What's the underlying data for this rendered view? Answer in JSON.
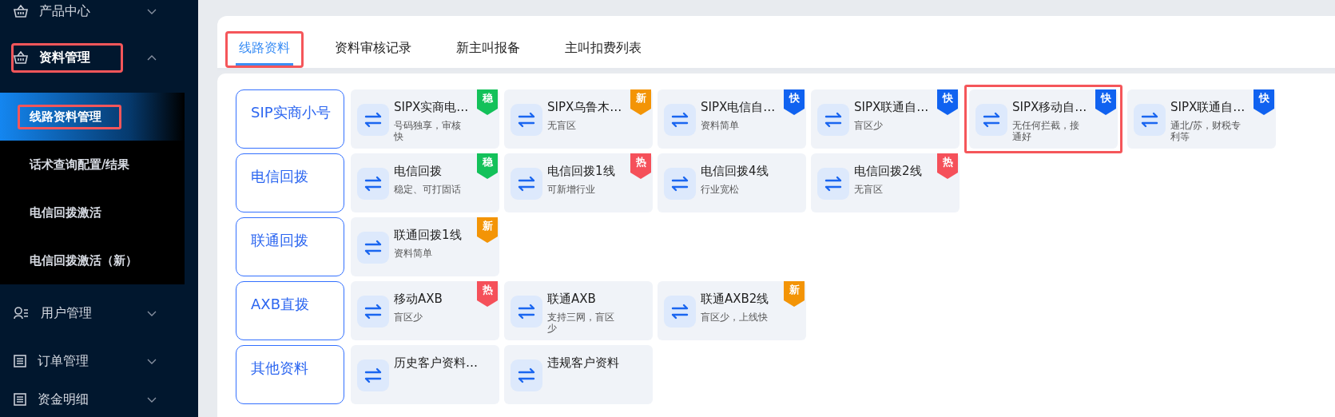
{
  "sidebar": {
    "items": [
      {
        "label": "产品中心",
        "expanded": false,
        "highlighted": false
      },
      {
        "label": "资料管理",
        "expanded": true,
        "highlighted": true,
        "children": [
          {
            "label": "线路资料管理",
            "selected": true,
            "highlighted": true
          },
          {
            "label": "话术查询配置/结果",
            "selected": false,
            "highlighted": false
          },
          {
            "label": "电信回拨激活",
            "selected": false,
            "highlighted": false
          },
          {
            "label": "电信回拨激活（新）",
            "selected": false,
            "highlighted": false
          }
        ]
      },
      {
        "label": "用户管理",
        "expanded": false,
        "highlighted": false
      },
      {
        "label": "订单管理",
        "expanded": false,
        "highlighted": false
      },
      {
        "label": "资金明细",
        "expanded": false,
        "highlighted": false
      }
    ]
  },
  "tabs": [
    {
      "label": "线路资料",
      "selected": true,
      "highlighted": true
    },
    {
      "label": "资料审核记录",
      "selected": false,
      "highlighted": false
    },
    {
      "label": "新主叫报备",
      "selected": false,
      "highlighted": false
    },
    {
      "label": "主叫扣费列表",
      "selected": false,
      "highlighted": false
    }
  ],
  "groups": [
    {
      "label": "SIP实商小号",
      "cards": [
        {
          "title": "SIPX实商电…",
          "desc": "号码独享，审核快",
          "badge": "稳",
          "color": "#13c15a",
          "highlighted": false
        },
        {
          "title": "SIPX乌鲁木…",
          "desc": "无盲区",
          "badge": "新",
          "color": "#f39406",
          "highlighted": false
        },
        {
          "title": "SIPX电信自…",
          "desc": "资料简单",
          "badge": "快",
          "color": "#1062f0",
          "highlighted": false
        },
        {
          "title": "SIPX联通自…",
          "desc": "盲区少",
          "badge": "快",
          "color": "#1062f0",
          "highlighted": false
        },
        {
          "title": "SIPX移动自…",
          "desc": "无任何拦截，接通好",
          "badge": "快",
          "color": "#1062f0",
          "highlighted": true
        },
        {
          "title": "SIPX联通自…",
          "desc": "通北/苏，财税专利等",
          "badge": "快",
          "color": "#1062f0",
          "highlighted": false
        }
      ]
    },
    {
      "label": "电信回拨",
      "cards": [
        {
          "title": "电信回拨",
          "desc": "稳定、可打固话",
          "badge": "稳",
          "color": "#13c15a",
          "highlighted": false
        },
        {
          "title": "电信回拨1线",
          "desc": "可新增行业",
          "badge": "热",
          "color": "#f5505a",
          "highlighted": false
        },
        {
          "title": "电信回拨4线",
          "desc": "行业宽松",
          "highlighted": false
        },
        {
          "title": "电信回拨2线",
          "desc": "无盲区",
          "badge": "热",
          "color": "#f5505a",
          "highlighted": false
        }
      ]
    },
    {
      "label": "联通回拨",
      "cards": [
        {
          "title": "联通回拨1线",
          "desc": "资料简单",
          "badge": "新",
          "color": "#f39406",
          "highlighted": false
        }
      ]
    },
    {
      "label": "AXB直拨",
      "cards": [
        {
          "title": "移动AXB",
          "desc": "盲区少",
          "badge": "热",
          "color": "#f5505a",
          "highlighted": false
        },
        {
          "title": "联通AXB",
          "desc": "支持三网，盲区少",
          "highlighted": false
        },
        {
          "title": "联通AXB2线",
          "desc": "盲区少，上线快",
          "badge": "新",
          "color": "#f39406",
          "highlighted": false
        }
      ]
    },
    {
      "label": "其他资料",
      "cards": [
        {
          "title": "历史客户资料…",
          "highlighted": false
        },
        {
          "title": "违规客户资料",
          "highlighted": false
        }
      ]
    }
  ]
}
